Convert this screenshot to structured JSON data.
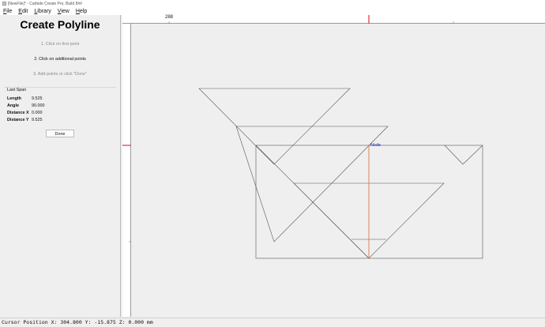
{
  "window": {
    "title": "[NewFile]* - Carbide Create Pro, Build 8##"
  },
  "menu": [
    "File",
    "Edit",
    "Library",
    "View",
    "Help"
  ],
  "panel": {
    "title": "Create Polyline",
    "steps": [
      "1. Click on first point",
      "2. Click on additional points",
      "3. Add points or click \"Done\""
    ],
    "active_step": 2,
    "last_span": {
      "header": "Last Span",
      "rows": [
        {
          "label": "Length",
          "value": "9.525"
        },
        {
          "label": "Angle",
          "value": "90.000"
        },
        {
          "label": "Distance X",
          "value": "0.000"
        },
        {
          "label": "Distance Y",
          "value": "9.525"
        }
      ]
    },
    "done_label": "Done"
  },
  "ruler": {
    "top_label": "288"
  },
  "canvas": {
    "node_label": "Node",
    "marker_color": "#e0303a",
    "segment_color": "#e07a40",
    "node_color": "#2020c0"
  },
  "status": {
    "cursor_text": "Cursor Position X: 304.800 Y: -15.875 Z: 0.000 mm"
  }
}
